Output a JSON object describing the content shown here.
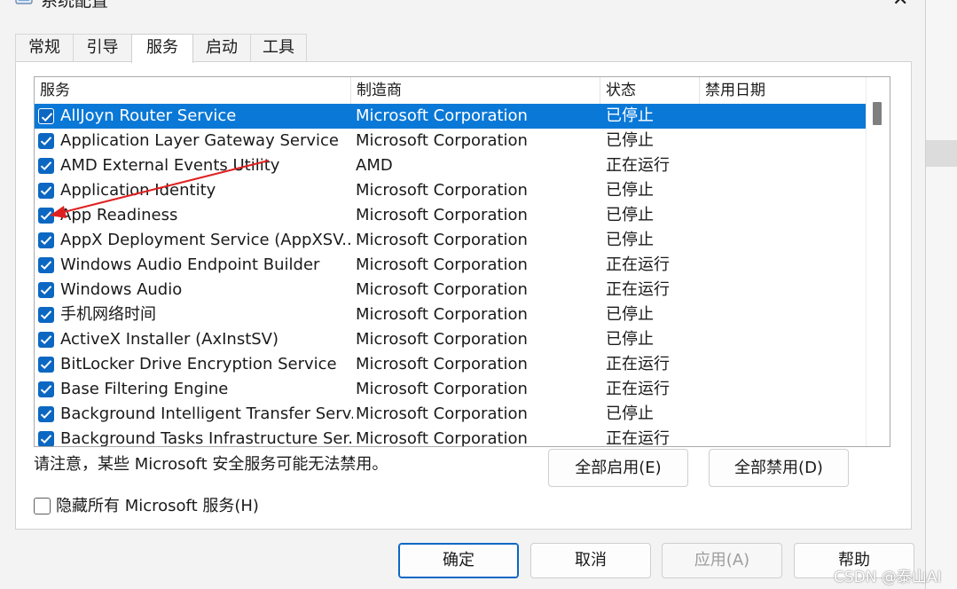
{
  "window": {
    "title": "系统配置",
    "close_icon": "close-icon"
  },
  "tabs": [
    {
      "label": "常规",
      "active": false
    },
    {
      "label": "引导",
      "active": false
    },
    {
      "label": "服务",
      "active": true
    },
    {
      "label": "启动",
      "active": false
    },
    {
      "label": "工具",
      "active": false
    }
  ],
  "services": {
    "columns": [
      "服务",
      "制造商",
      "状态",
      "禁用日期"
    ],
    "rows": [
      {
        "name": "AllJoyn Router Service",
        "manufacturer": "Microsoft Corporation",
        "status": "已停止",
        "checked": true,
        "selected": true
      },
      {
        "name": "Application Layer Gateway Service",
        "manufacturer": "Microsoft Corporation",
        "status": "已停止",
        "checked": true
      },
      {
        "name": "AMD External Events Utility",
        "manufacturer": "AMD",
        "status": "正在运行",
        "checked": true
      },
      {
        "name": "Application Identity",
        "manufacturer": "Microsoft Corporation",
        "status": "已停止",
        "checked": true
      },
      {
        "name": "App Readiness",
        "manufacturer": "Microsoft Corporation",
        "status": "已停止",
        "checked": true
      },
      {
        "name": "AppX Deployment Service (AppXSV...",
        "manufacturer": "Microsoft Corporation",
        "status": "已停止",
        "checked": true
      },
      {
        "name": "Windows Audio Endpoint Builder",
        "manufacturer": "Microsoft Corporation",
        "status": "正在运行",
        "checked": true
      },
      {
        "name": "Windows Audio",
        "manufacturer": "Microsoft Corporation",
        "status": "正在运行",
        "checked": true
      },
      {
        "name": "手机网络时间",
        "manufacturer": "Microsoft Corporation",
        "status": "已停止",
        "checked": true
      },
      {
        "name": "ActiveX Installer (AxInstSV)",
        "manufacturer": "Microsoft Corporation",
        "status": "已停止",
        "checked": true
      },
      {
        "name": "BitLocker Drive Encryption Service",
        "manufacturer": "Microsoft Corporation",
        "status": "正在运行",
        "checked": true
      },
      {
        "name": "Base Filtering Engine",
        "manufacturer": "Microsoft Corporation",
        "status": "正在运行",
        "checked": true
      },
      {
        "name": "Background Intelligent Transfer Serv...",
        "manufacturer": "Microsoft Corporation",
        "status": "已停止",
        "checked": true
      },
      {
        "name": "Background Tasks Infrastructure Ser...",
        "manufacturer": "Microsoft Corporation",
        "status": "正在运行",
        "checked": true
      }
    ]
  },
  "note": "请注意，某些 Microsoft 安全服务可能无法禁用。",
  "buttons": {
    "enable_all": "全部启用(E)",
    "disable_all": "全部禁用(D)",
    "ok": "确定",
    "cancel": "取消",
    "apply": "应用(A)",
    "help": "帮助"
  },
  "hide_ms_services": {
    "label": "隐藏所有 Microsoft 服务(H)",
    "checked": false
  },
  "watermark": "CSDN @泰山AI",
  "colors": {
    "accent": "#0a78d7",
    "checkbox": "#0b67c2",
    "annotation_arrow": "#e02020"
  }
}
